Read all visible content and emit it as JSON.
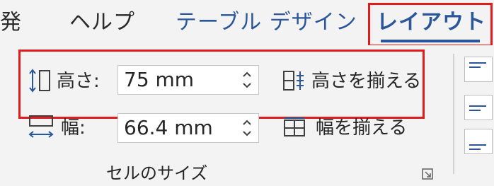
{
  "tabs": [
    {
      "label": "発"
    },
    {
      "label": "ヘルプ"
    },
    {
      "label": "テーブル デザイン"
    },
    {
      "label": "レイアウト",
      "active": true
    }
  ],
  "cell_size": {
    "height_label": "高さ:",
    "height_value": "75 mm",
    "width_label": "幅:",
    "width_value": "66.4 mm",
    "distribute_rows_label": "高さを揃える",
    "distribute_columns_label": "幅を揃える",
    "group_label": "セルのサイズ"
  },
  "colors": {
    "accent": "#2b579a",
    "highlight": "#e01b1b",
    "icon_blue": "#2b579a"
  },
  "icons": {
    "height": "row-height-icon",
    "width": "column-width-icon",
    "distribute_rows": "distribute-rows-icon",
    "distribute_columns": "distribute-columns-icon",
    "launcher": "dialog-launcher-icon",
    "align": "align-left-icon"
  }
}
